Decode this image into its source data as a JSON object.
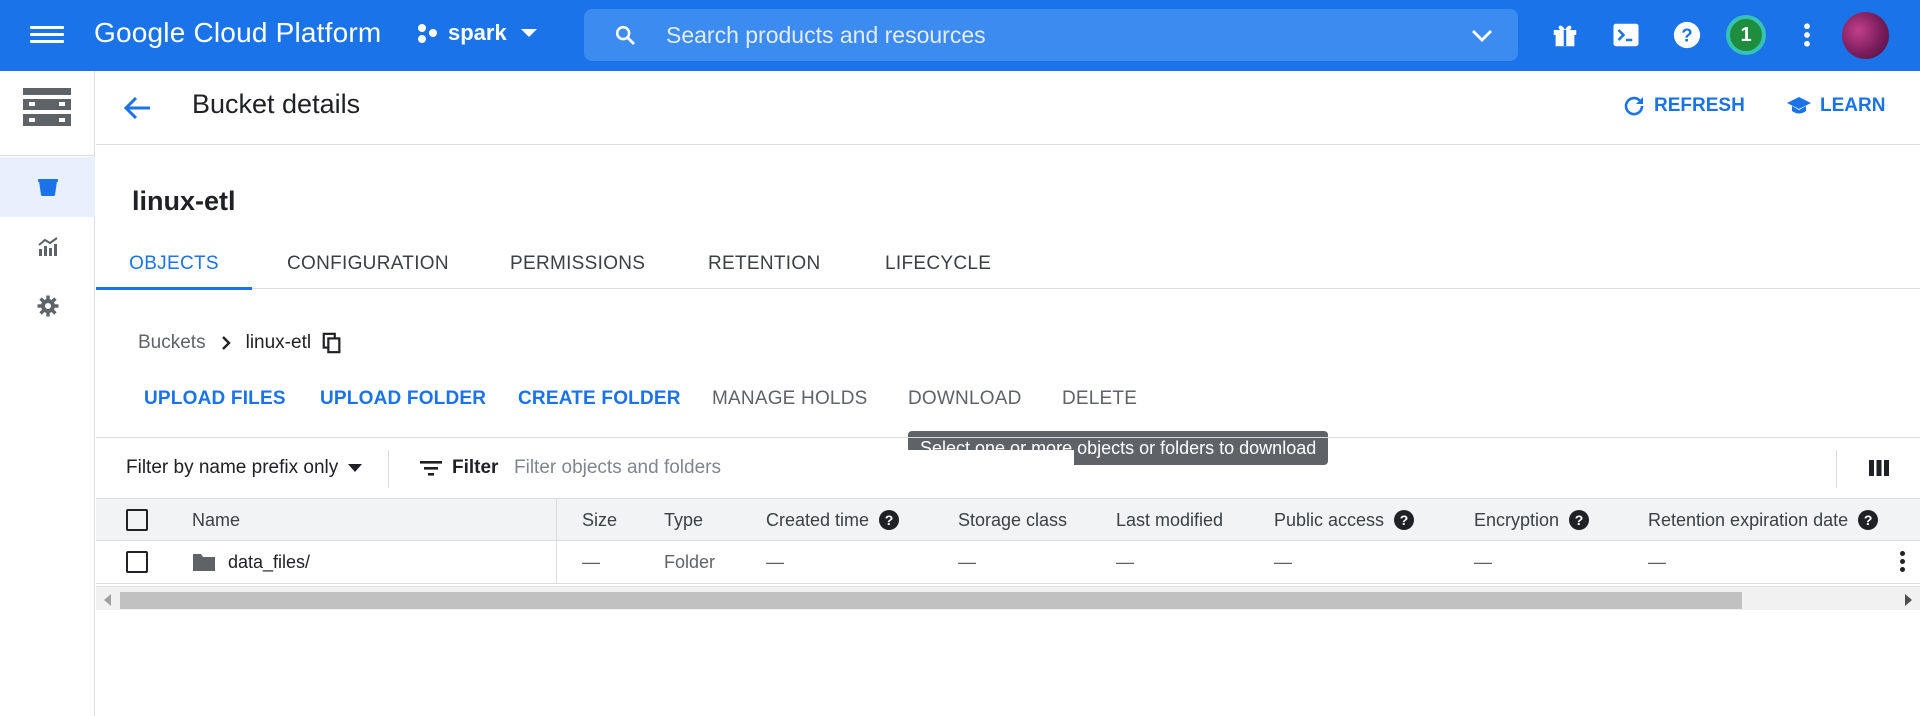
{
  "app": {
    "brand": "Google Cloud Platform",
    "project": "spark",
    "search_placeholder": "Search products and resources",
    "notification_count": "1"
  },
  "header": {
    "title": "Bucket details",
    "refresh_label": "REFRESH",
    "learn_label": "LEARN"
  },
  "bucket": {
    "name": "linux-etl"
  },
  "tabs": [
    {
      "label": "OBJECTS",
      "active": true
    },
    {
      "label": "CONFIGURATION"
    },
    {
      "label": "PERMISSIONS"
    },
    {
      "label": "RETENTION"
    },
    {
      "label": "LIFECYCLE"
    }
  ],
  "breadcrumb": {
    "root": "Buckets",
    "current": "linux-etl"
  },
  "actions": {
    "upload_files": "UPLOAD FILES",
    "upload_folder": "UPLOAD FOLDER",
    "create_folder": "CREATE FOLDER",
    "manage_holds": "MANAGE HOLDS",
    "download": "DOWNLOAD",
    "delete": "DELETE",
    "download_tooltip": "Select one or more objects or folders to download"
  },
  "filter": {
    "mode": "Filter by name prefix only",
    "button": "Filter",
    "placeholder": "Filter objects and folders"
  },
  "table": {
    "columns": [
      "Name",
      "Size",
      "Type",
      "Created time",
      "Storage class",
      "Last modified",
      "Public access",
      "Encryption",
      "Retention expiration date"
    ],
    "rows": [
      {
        "name": "data_files/",
        "size": "—",
        "type": "Folder",
        "created": "—",
        "storage_class": "—",
        "last_modified": "—",
        "public_access": "—",
        "encryption": "—",
        "retention": "—"
      }
    ]
  },
  "colors": {
    "brand_blue": "#1a73e8",
    "tooltip_bg": "#5f6368",
    "notification_badge": "#1e8e3e"
  },
  "icons": [
    "menu-icon",
    "project-icon",
    "search-icon",
    "chevron-down-icon",
    "gift-icon",
    "terminal-icon",
    "help-icon",
    "more-vert-icon",
    "storage-icon",
    "bucket-icon",
    "monitoring-icon",
    "settings-icon",
    "back-arrow-icon",
    "refresh-icon",
    "learn-icon",
    "chevron-right-icon",
    "copy-icon",
    "filter-icon",
    "columns-icon",
    "folder-icon"
  ]
}
